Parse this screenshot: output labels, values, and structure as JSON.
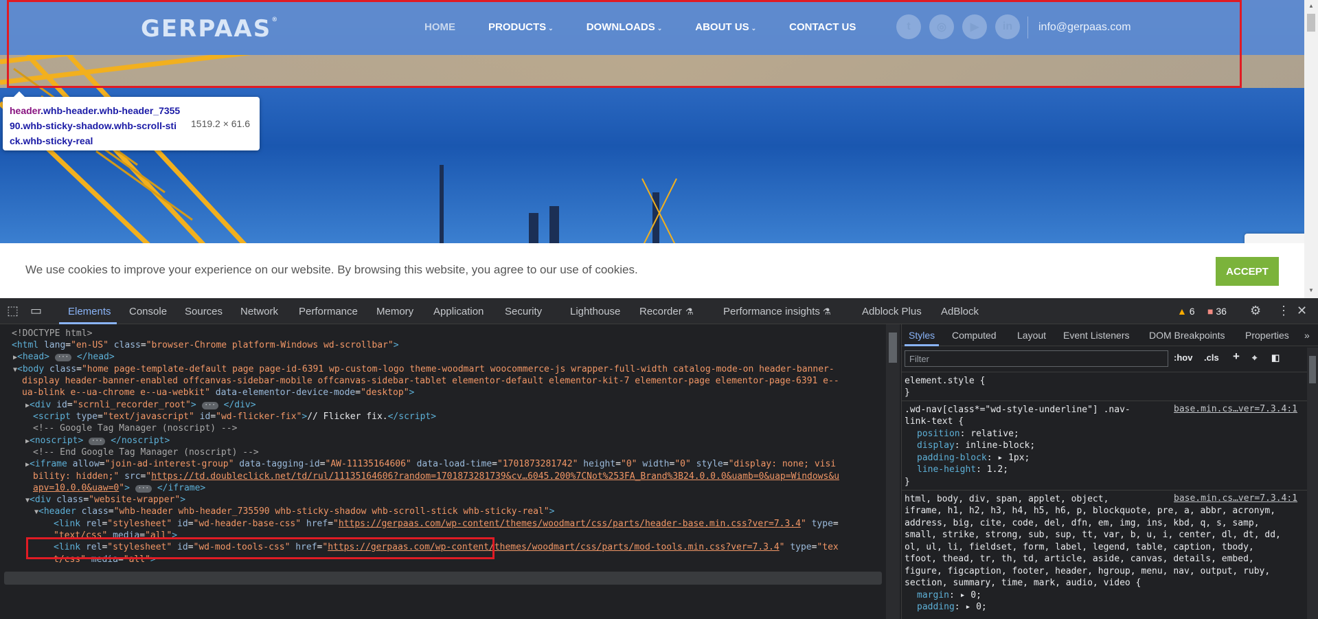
{
  "site": {
    "logo": "GERPAAS",
    "logo_mark": "®",
    "nav": [
      {
        "label": "HOME",
        "chevron": ""
      },
      {
        "label": "PRODUCTS",
        "chevron": "⌄"
      },
      {
        "label": "DOWNLOADS",
        "chevron": "⌄"
      },
      {
        "label": "ABOUT US",
        "chevron": "⌄"
      },
      {
        "label": "CONTACT US",
        "chevron": ""
      }
    ],
    "socials": [
      "twitter",
      "instagram",
      "youtube",
      "linkedin"
    ],
    "social_glyphs": [
      "t",
      "◎",
      "▶",
      "in"
    ],
    "email": "info@gerpaas.com",
    "cookie_text": "We use cookies to improve your experience on our website. By browsing this website, you agree to our use of cookies.",
    "accept_label": "ACCEPT",
    "colors": {
      "header": "#5f8bce",
      "accept": "#7bb33b",
      "highlight": "#e01b24"
    }
  },
  "inspect_tooltip": {
    "tag": "header",
    "selector": ".whb-header.whb-header_735590.whb-sticky-shadow.whb-scroll-stick.whb-sticky-real",
    "size": "1519.2 × 61.6"
  },
  "devtools": {
    "tabs": [
      "Elements",
      "Console",
      "Sources",
      "Network",
      "Performance",
      "Memory",
      "Application",
      "Security",
      "Lighthouse",
      "Recorder",
      "Performance insights",
      "Adblock Plus",
      "AdBlock"
    ],
    "warnings": "6",
    "issues": "36",
    "styles_tabs": [
      "Styles",
      "Computed",
      "Layout",
      "Event Listeners",
      "DOM Breakpoints",
      "Properties"
    ],
    "filter_placeholder": "Filter",
    "hov_label": ":hov",
    "cls_label": ".cls",
    "rules": [
      {
        "selector": "element.style {",
        "source": ""
      },
      {
        "selector": ".wd-nav[class*=\"wd-style-underline\"] .nav-",
        "selector2": "link-text {",
        "source": "base.min.cs…ver=7.3.4:1",
        "props": [
          [
            "position",
            "relative;"
          ],
          [
            "display",
            "inline-block;"
          ],
          [
            "padding-block",
            "▸ 1px;"
          ],
          [
            "line-height",
            "1.2;"
          ]
        ]
      },
      {
        "selector": "html, body, div, span, applet, object,",
        "source": "base.min.cs…ver=7.3.4:1",
        "lines": [
          "iframe, h1, h2, h3, h4, h5, h6, p, blockquote, pre, a, abbr, acronym,",
          "address, big, cite, code, del, dfn, em, img, ins, kbd, q, s, samp,",
          "small, strike, strong, sub, sup, tt, var, b, u, i, center, dl, dt, dd,",
          "ol, ul, li, fieldset, form, label, legend, table, caption, tbody,",
          "tfoot, thead, tr, th, td, article, aside, canvas, details, embed,",
          "figure, figcaption, footer, header, hgroup, menu, nav, output, ruby,",
          "section, summary, time, mark, audio, video {"
        ],
        "props": [
          [
            "margin",
            "▸ 0;"
          ],
          [
            "padding",
            "▸ 0;"
          ]
        ]
      }
    ]
  }
}
